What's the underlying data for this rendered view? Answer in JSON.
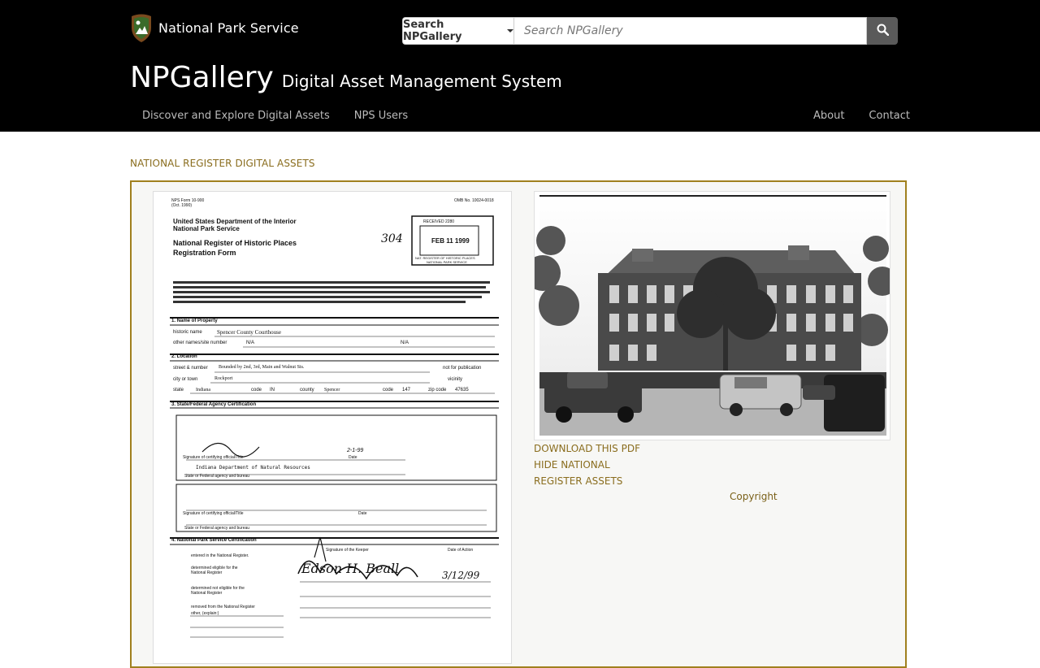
{
  "header": {
    "logo_text": "National Park Service",
    "search": {
      "dropdown_label": "Search NPGallery",
      "placeholder": "Search NPGallery"
    },
    "brand": {
      "title": "NPGallery",
      "subtitle": "Digital Asset Management System"
    },
    "nav_left": [
      "Discover and Explore Digital Assets",
      "NPS Users"
    ],
    "nav_right": [
      "About",
      "Contact"
    ]
  },
  "main": {
    "section_title": "NATIONAL REGISTER DIGITAL ASSETS",
    "links": {
      "download": "DOWNLOAD THIS PDF",
      "hide_line1": "HIDE NATIONAL",
      "hide_line2": "REGISTER ASSETS"
    },
    "copyright": "Copyright"
  },
  "document": {
    "form_no": "NPS Form 10-900",
    "form_date": "(Oct. 1990)",
    "omb": "OMB No. 10024-0018",
    "dept": "United States Department of the Interior",
    "agency": "National Park Service",
    "title1": "National Register of Historic Places",
    "title2": "Registration Form",
    "stamp_received": "RECEIVED 2280",
    "stamp_date": "FEB 11 1999",
    "stamp_footer1": "NAT. REGISTER OF HISTORIC PLACES",
    "stamp_footer2": "NATIONAL PARK SERVICE",
    "handwritten_num": "304",
    "sec1": "1. Name of Property",
    "historic_name_label": "historic name",
    "historic_name": "Spencer County Courthouse",
    "other_names_label": "other names/site number",
    "na": "N/A",
    "sec2": "2. Location",
    "street_label": "street & number",
    "street": "Bounded by 2nd, 3rd, Main and Walnut Sts.",
    "not_pub": "not for publication",
    "city_label": "city or town",
    "city": "Rockport",
    "vicinity": "vicinity",
    "state_label": "state",
    "state": "Indiana",
    "code_label": "code",
    "state_code": "IN",
    "county_label": "county",
    "county": "Spencer",
    "county_code": "147",
    "zip_label": "zip code",
    "zip": "47635",
    "sec3": "3. State/Federal Agency Certification",
    "sig_date": "2-1-99",
    "sig_title_label": "Signature of certifying official/Title",
    "date_label": "Date",
    "agency_name": "Indiana Department of Natural Resources",
    "agency_label": "State or Federal agency and bureau",
    "sec4": "4. National Park Service Certification",
    "keeper_label": "Signature of the Keeper",
    "action_label": "Date of Action",
    "keeper_sig": "Edson H. Beall",
    "keeper_date": "3/12/99",
    "entered": "entered in the National Register.",
    "eligible": "determined eligible for the National Register",
    "not_eligible": "determined not eligible for the National Register",
    "removed": "removed from the National Register",
    "other": "other, (explain:)"
  },
  "colors": {
    "header_bg": "#000000",
    "accent_gold": "#8a6d1e",
    "panel_border": "#a0801e",
    "search_button": "#5a5a5a"
  }
}
